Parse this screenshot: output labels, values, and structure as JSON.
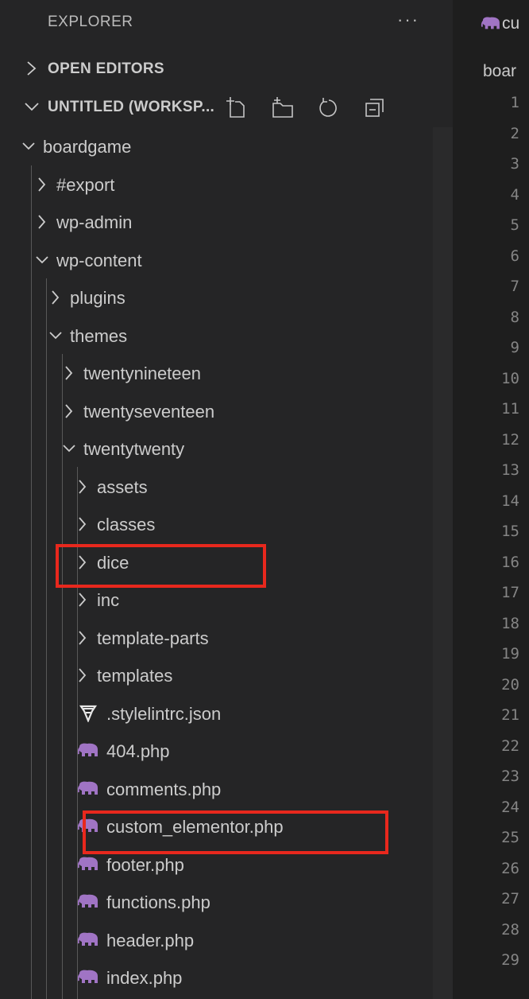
{
  "explorer": {
    "title": "EXPLORER",
    "more_label": "···",
    "open_editors_label": "OPEN EDITORS",
    "workspace_label": "UNTITLED (WORKSP...",
    "tree": [
      {
        "label": "boardgame",
        "kind": "folder",
        "expanded": true,
        "depth": 0
      },
      {
        "label": "#export",
        "kind": "folder",
        "expanded": false,
        "depth": 1
      },
      {
        "label": "wp-admin",
        "kind": "folder",
        "expanded": false,
        "depth": 1
      },
      {
        "label": "wp-content",
        "kind": "folder",
        "expanded": true,
        "depth": 1
      },
      {
        "label": "plugins",
        "kind": "folder",
        "expanded": false,
        "depth": 2
      },
      {
        "label": "themes",
        "kind": "folder",
        "expanded": true,
        "depth": 2
      },
      {
        "label": "twentynineteen",
        "kind": "folder",
        "expanded": false,
        "depth": 3
      },
      {
        "label": "twentyseventeen",
        "kind": "folder",
        "expanded": false,
        "depth": 3
      },
      {
        "label": "twentytwenty",
        "kind": "folder",
        "expanded": true,
        "depth": 3
      },
      {
        "label": "assets",
        "kind": "folder",
        "expanded": false,
        "depth": 4
      },
      {
        "label": "classes",
        "kind": "folder",
        "expanded": false,
        "depth": 4
      },
      {
        "label": "dice",
        "kind": "folder",
        "expanded": false,
        "depth": 4,
        "highlighted": true
      },
      {
        "label": "inc",
        "kind": "folder",
        "expanded": false,
        "depth": 4
      },
      {
        "label": "template-parts",
        "kind": "folder",
        "expanded": false,
        "depth": 4
      },
      {
        "label": "templates",
        "kind": "folder",
        "expanded": false,
        "depth": 4
      },
      {
        "label": ".stylelintrc.json",
        "kind": "stylelint-file",
        "depth": 4
      },
      {
        "label": "404.php",
        "kind": "php-file",
        "depth": 4
      },
      {
        "label": "comments.php",
        "kind": "php-file",
        "depth": 4
      },
      {
        "label": "custom_elementor.php",
        "kind": "php-file",
        "depth": 4,
        "highlighted": true
      },
      {
        "label": "footer.php",
        "kind": "php-file",
        "depth": 4
      },
      {
        "label": "functions.php",
        "kind": "php-file",
        "depth": 4
      },
      {
        "label": "header.php",
        "kind": "php-file",
        "depth": 4
      },
      {
        "label": "index.php",
        "kind": "php-file",
        "depth": 4
      }
    ]
  },
  "editor": {
    "tab_label": "cu",
    "breadcrumb": "boar",
    "line_numbers": [
      "1",
      "2",
      "3",
      "4",
      "5",
      "6",
      "7",
      "8",
      "9",
      "10",
      "11",
      "12",
      "13",
      "14",
      "15",
      "16",
      "17",
      "18",
      "19",
      "20",
      "21",
      "22",
      "23",
      "24",
      "25",
      "26",
      "27",
      "28",
      "29"
    ]
  },
  "colors": {
    "sidebar_bg": "#252526",
    "editor_bg": "#1e1e1e",
    "text": "#cccccc",
    "line_number": "#858585",
    "php_icon": "#a074c4",
    "highlight_box": "#e8281d"
  },
  "icons": {
    "chevron_right": "chevron-right-icon",
    "chevron_down": "chevron-down-icon",
    "php_file": "php-elephant-icon",
    "stylelint_file": "stylelint-icon",
    "new_file": "new-file-icon",
    "new_folder": "new-folder-icon",
    "refresh": "refresh-icon",
    "collapse_all": "collapse-all-icon"
  }
}
